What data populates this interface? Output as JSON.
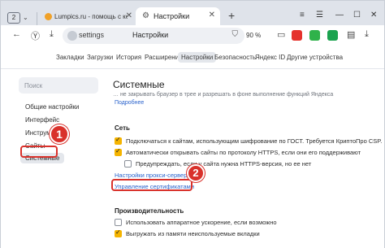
{
  "tabs": {
    "count": "2",
    "tab1_title": "Lumpics.ru - помощь с ко",
    "tab2_title": "Настройки"
  },
  "address": {
    "url": "settings",
    "title": "Настройки",
    "zoom": "90 %"
  },
  "settings_nav": [
    "Закладки",
    "Загрузки",
    "История",
    "Расширения",
    "Настройки",
    "Безопасность",
    "Яндекс ID",
    "Другие устройства"
  ],
  "sidebar": {
    "search_placeholder": "Поиск",
    "items": [
      "Общие настройки",
      "Интерфейс",
      "Инструменты",
      "Сайты",
      "Системные"
    ]
  },
  "main": {
    "title": "Системные",
    "cut_text": "… не закрывать браузер в трее и разрешать в фоне выполнение функций Яндекса",
    "more_link": "Подробнее",
    "network_heading": "Сеть",
    "net_options": [
      "Подключаться к сайтам, использующим шифрование по ГОСТ. Требуется КриптоПро CSP.",
      "Автоматически открывать сайты по протоколу HTTPS, если они его поддерживают",
      "Предупреждать, если у сайта нужна HTTPS-версия, но ее нет"
    ],
    "proxy_link": "Настройки прокси-сервера",
    "certs_link": "Управление сертификатами",
    "perf_heading": "Производительность",
    "perf_options": [
      "Использовать аппаратное ускорение, если возможно",
      "Выгружать из памяти неиспользуемые вкладки"
    ]
  },
  "callouts": [
    "1",
    "2"
  ],
  "colors": {
    "accent": "#f5b400",
    "link": "#2a63cc",
    "callout": "#d9312b"
  }
}
